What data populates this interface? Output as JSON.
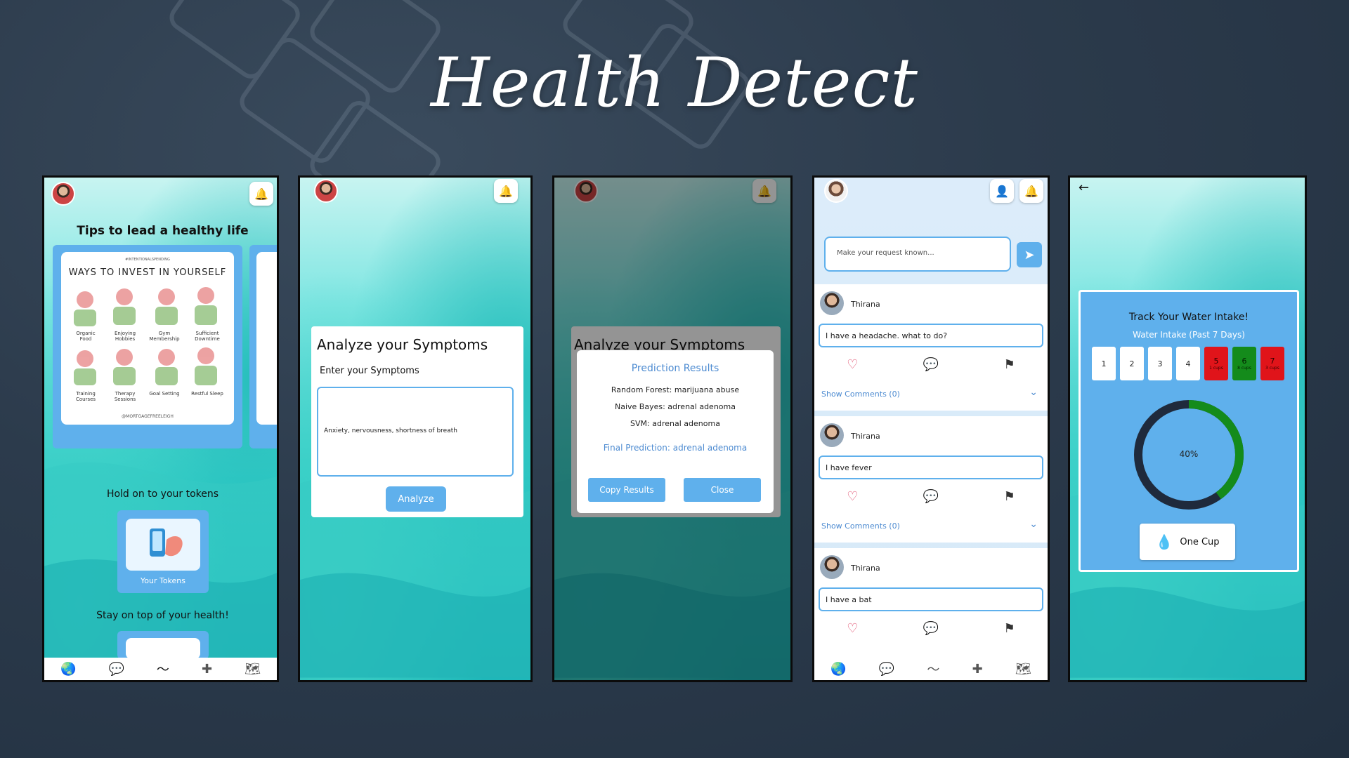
{
  "title": "Health Detect",
  "screen1": {
    "tips_heading": "Tips to lead a healthy life",
    "poster_tag": "#INTENTIONALSPENDING",
    "poster_title": "WAYS TO INVEST IN YOURSELF",
    "poster_items": [
      "Organic Food",
      "Enjoying Hobbies",
      "Gym Membership",
      "Sufficient Downtime",
      "Training Courses",
      "Therapy Sessions",
      "Goal Setting",
      "Restful Sleep"
    ],
    "poster_credit": "@MORTGAGEFREELEIGH",
    "tokens_heading": "Hold on to your tokens",
    "tokens_label": "Your Tokens",
    "health_heading": "Stay on top of your health!"
  },
  "screen2": {
    "card_title": "Analyze your Symptoms",
    "field_label": "Enter your Symptoms",
    "symptoms_value": "Anxiety, nervousness, shortness of breath",
    "analyze_label": "Analyze"
  },
  "screen3": {
    "bg_title": "Analyze your Symptoms",
    "dialog_title": "Prediction Results",
    "results": [
      "Random Forest: marijuana abuse",
      "Naive Bayes: adrenal adenoma",
      "SVM: adrenal adenoma"
    ],
    "final": "Final Prediction: adrenal adenoma",
    "copy_label": "Copy Results",
    "close_label": "Close"
  },
  "screen4": {
    "placeholder": "Make your request known...",
    "posts": [
      {
        "name": "Thirana",
        "message": "I have a headache. what to do?",
        "comments": "Show Comments (0)"
      },
      {
        "name": "Thirana",
        "message": "I have fever",
        "comments": "Show Comments (0)"
      },
      {
        "name": "Thirana",
        "message": "I have a bat",
        "comments": ""
      }
    ]
  },
  "screen5": {
    "heading": "Track Your Water Intake!",
    "subheading": "Water Intake (Past 7 Days)",
    "days": [
      {
        "n": "1",
        "cups": ""
      },
      {
        "n": "2",
        "cups": ""
      },
      {
        "n": "3",
        "cups": ""
      },
      {
        "n": "4",
        "cups": ""
      },
      {
        "n": "5",
        "cups": "1 cups"
      },
      {
        "n": "6",
        "cups": "8 cups"
      },
      {
        "n": "7",
        "cups": "3 cups"
      }
    ],
    "progress_label": "40%",
    "progress_fraction": 0.4,
    "cup_button": "One Cup"
  },
  "colors": {
    "accent": "#5fb0ec",
    "progress": "#148b1b",
    "ring": "#1f2a3c"
  }
}
